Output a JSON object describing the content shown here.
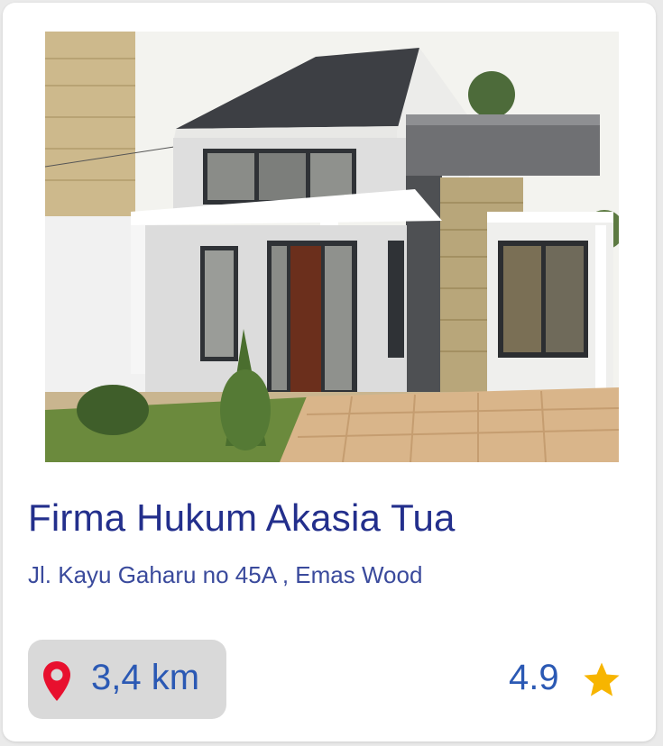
{
  "place": {
    "name": "Firma Hukum Akasia Tua",
    "address": "Jl. Kayu Gaharu no 45A , Emas Wood",
    "distance": "3,4 km",
    "rating": "4.9"
  },
  "icons": {
    "location": "map-pin-icon",
    "rating": "star-icon"
  },
  "colors": {
    "title": "#232f8c",
    "address": "#3a4a9c",
    "value_text": "#2b59b4",
    "pin": "#e8102e",
    "star": "#f7b500",
    "chip_background": "#d9d9d9"
  }
}
